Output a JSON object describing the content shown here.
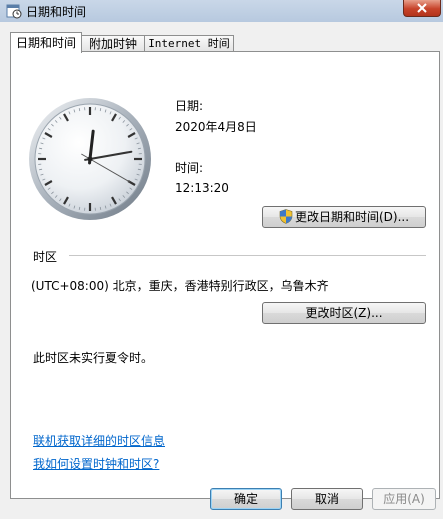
{
  "window": {
    "title": "日期和时间"
  },
  "tabs": [
    {
      "label": "日期和时间",
      "active": true
    },
    {
      "label": "附加时钟",
      "active": false
    },
    {
      "label": "Internet 时间",
      "active": false
    }
  ],
  "clock": {
    "hours": 12,
    "minutes": 13,
    "seconds": 20
  },
  "date": {
    "label": "日期:",
    "value": "2020年4月8日"
  },
  "time": {
    "label": "时间:",
    "value": "12:13:20"
  },
  "buttons": {
    "change_datetime": "更改日期和时间(D)...",
    "change_timezone": "更改时区(Z)...",
    "ok": "确定",
    "cancel": "取消",
    "apply": "应用(A)"
  },
  "timezone": {
    "section_label": "时区",
    "value": "(UTC+08:00) 北京，重庆，香港特别行政区，乌鲁木齐",
    "dst_note": "此时区未实行夏令时。"
  },
  "links": {
    "online_info": "联机获取详细的时区信息",
    "how_to": "我如何设置时钟和时区?"
  },
  "colors": {
    "link": "#0066cc",
    "accent": "#3c7fb1"
  }
}
